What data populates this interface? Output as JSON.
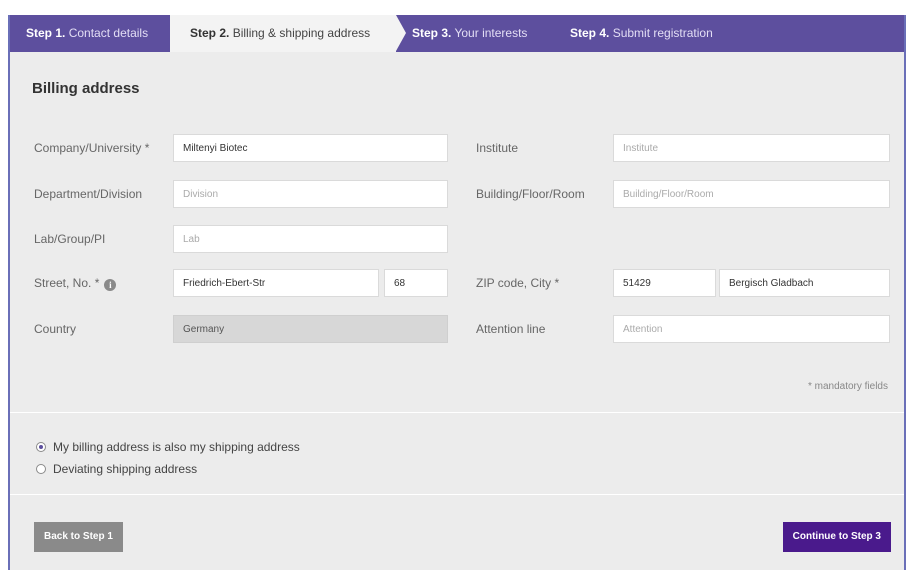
{
  "steps": [
    {
      "num": "Step 1.",
      "label": "Contact details"
    },
    {
      "num": "Step 2.",
      "label": "Billing & shipping address"
    },
    {
      "num": "Step 3.",
      "label": "Your interests"
    },
    {
      "num": "Step 4.",
      "label": "Submit registration"
    }
  ],
  "billing": {
    "title": "Billing address",
    "company": {
      "label": "Company/University *",
      "value": "Miltenyi Biotec",
      "placeholder": ""
    },
    "department": {
      "label": "Department/Division",
      "value": "",
      "placeholder": "Division"
    },
    "lab": {
      "label": "Lab/Group/PI",
      "value": "",
      "placeholder": "Lab"
    },
    "street": {
      "label": "Street, No. *",
      "value": "Friedrich-Ebert-Str",
      "number": "68"
    },
    "country": {
      "label": "Country",
      "value": "Germany"
    },
    "institute": {
      "label": "Institute",
      "value": "",
      "placeholder": "Institute"
    },
    "building": {
      "label": "Building/Floor/Room",
      "value": "",
      "placeholder": "Building/Floor/Room"
    },
    "zip_city": {
      "label": "ZIP code, City *",
      "zip": "51429",
      "city": "Bergisch Gladbach"
    },
    "attention": {
      "label": "Attention line",
      "value": "",
      "placeholder": "Attention"
    },
    "mandatory_note": "* mandatory fields"
  },
  "shipping": {
    "option_same": "My billing address is also my shipping address",
    "option_deviating": "Deviating shipping address",
    "selected": "same"
  },
  "buttons": {
    "back": "Back to Step 1",
    "continue": "Continue to Step 3"
  },
  "colors": {
    "stepper_bg": "#5d4f9e",
    "continue_bg": "#4a1a8c",
    "back_bg": "#8a8a8a"
  }
}
